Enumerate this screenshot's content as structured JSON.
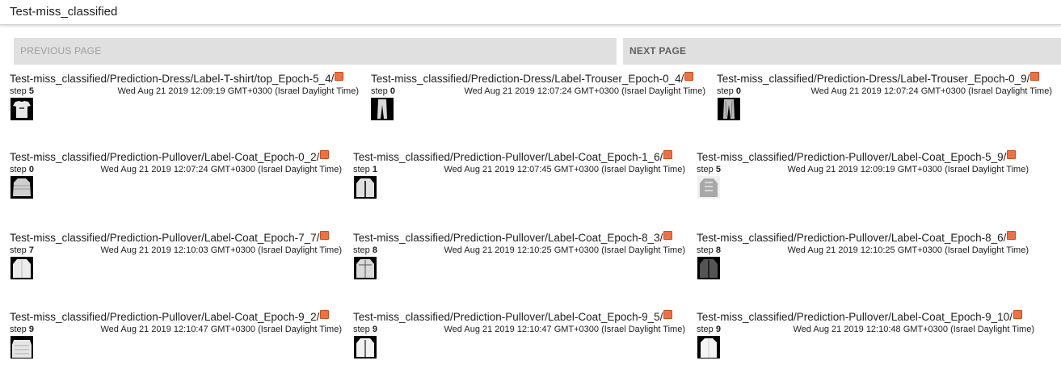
{
  "header": {
    "title": "Test-miss_classified"
  },
  "pager": {
    "previous_label": "PREVIOUS PAGE",
    "next_label": "NEXT PAGE"
  },
  "step_label": "step",
  "cards": [
    {
      "tag": "Test-miss_classified/Prediction-Dress/Label-T-shirt/top_Epoch-5_4/",
      "step": "5",
      "time": "Wed Aug 21 2019 12:09:19 GMT+0300 (Israel Daylight Time)",
      "thumb": "tshirt-thumbnail"
    },
    {
      "tag": "Test-miss_classified/Prediction-Dress/Label-Trouser_Epoch-0_4/",
      "step": "0",
      "time": "Wed Aug 21 2019 12:07:24 GMT+0300 (Israel Daylight Time)",
      "thumb": "trouser-thumbnail"
    },
    {
      "tag": "Test-miss_classified/Prediction-Dress/Label-Trouser_Epoch-0_9/",
      "step": "0",
      "time": "Wed Aug 21 2019 12:07:24 GMT+0300 (Israel Daylight Time)",
      "thumb": "trouser-thumbnail"
    },
    {
      "tag": "Test-miss_classified/Prediction-Pullover/Label-Coat_Epoch-0_2/",
      "step": "0",
      "time": "Wed Aug 21 2019 12:07:24 GMT+0300 (Israel Daylight Time)",
      "thumb": "coat-thumbnail"
    },
    {
      "tag": "Test-miss_classified/Prediction-Pullover/Label-Coat_Epoch-1_6/",
      "step": "1",
      "time": "Wed Aug 21 2019 12:07:45 GMT+0300 (Israel Daylight Time)",
      "thumb": "coat-thumbnail"
    },
    {
      "tag": "Test-miss_classified/Prediction-Pullover/Label-Coat_Epoch-5_9/",
      "step": "5",
      "time": "Wed Aug 21 2019 12:09:19 GMT+0300 (Israel Daylight Time)",
      "thumb": "coat-thumbnail"
    },
    {
      "tag": "Test-miss_classified/Prediction-Pullover/Label-Coat_Epoch-7_7/",
      "step": "7",
      "time": "Wed Aug 21 2019 12:10:03 GMT+0300 (Israel Daylight Time)",
      "thumb": "coat-thumbnail"
    },
    {
      "tag": "Test-miss_classified/Prediction-Pullover/Label-Coat_Epoch-8_3/",
      "step": "8",
      "time": "Wed Aug 21 2019 12:10:25 GMT+0300 (Israel Daylight Time)",
      "thumb": "coat-thumbnail"
    },
    {
      "tag": "Test-miss_classified/Prediction-Pullover/Label-Coat_Epoch-8_6/",
      "step": "8",
      "time": "Wed Aug 21 2019 12:10:25 GMT+0300 (Israel Daylight Time)",
      "thumb": "coat-thumbnail"
    },
    {
      "tag": "Test-miss_classified/Prediction-Pullover/Label-Coat_Epoch-9_2/",
      "step": "9",
      "time": "Wed Aug 21 2019 12:10:47 GMT+0300 (Israel Daylight Time)",
      "thumb": "coat-thumbnail"
    },
    {
      "tag": "Test-miss_classified/Prediction-Pullover/Label-Coat_Epoch-9_5/",
      "step": "9",
      "time": "Wed Aug 21 2019 12:10:47 GMT+0300 (Israel Daylight Time)",
      "thumb": "coat-thumbnail"
    },
    {
      "tag": "Test-miss_classified/Prediction-Pullover/Label-Coat_Epoch-9_10/",
      "step": "9",
      "time": "Wed Aug 21 2019 12:10:48 GMT+0300 (Israel Daylight Time)",
      "thumb": "coat-thumbnail"
    }
  ],
  "colors": {
    "flag": "#f07040",
    "pager_bg": "#e0e0e0",
    "thumb_bg": "#000000"
  }
}
